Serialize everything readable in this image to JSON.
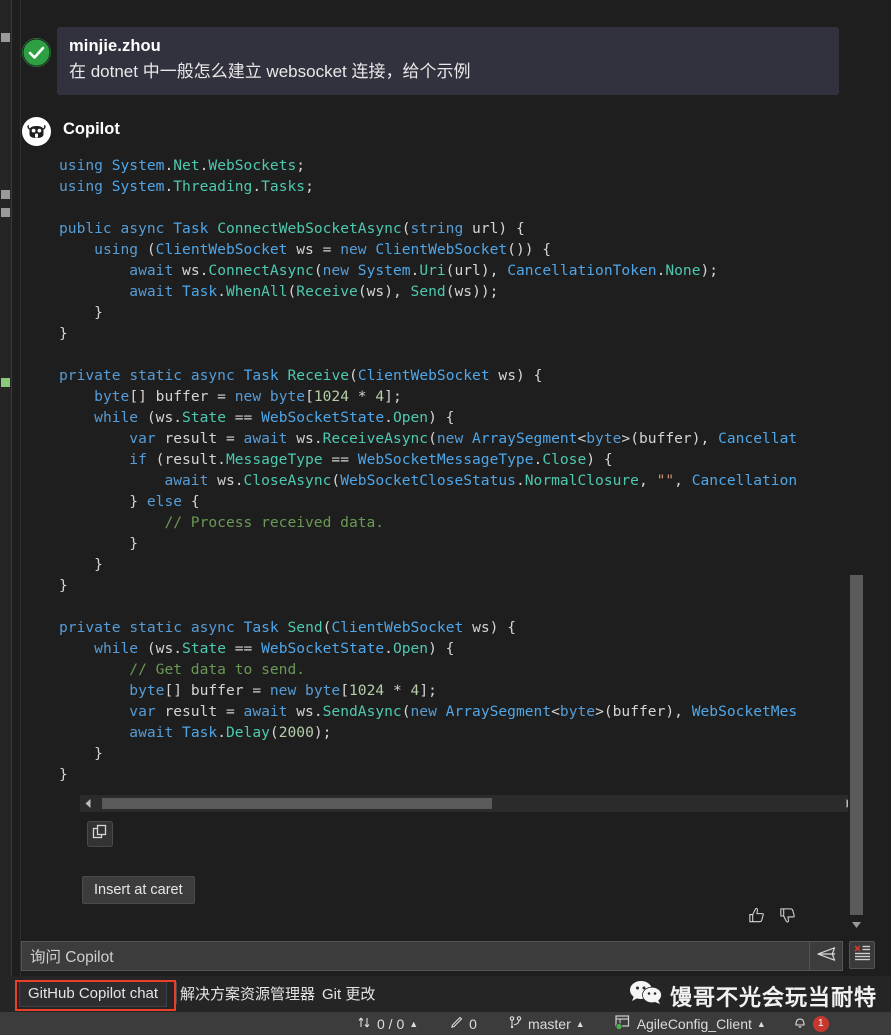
{
  "user_message": {
    "avatar_icon": "check-circle-icon",
    "name": "minjie.zhou",
    "text": "在 dotnet 中一般怎么建立 websocket 连接，给个示例"
  },
  "assistant": {
    "avatar_icon": "copilot-robot-icon",
    "name": "Copilot",
    "code": "using System.Net.WebSockets;\nusing System.Threading.Tasks;\n\npublic async Task ConnectWebSocketAsync(string url) {\n    using (ClientWebSocket ws = new ClientWebSocket()) {\n        await ws.ConnectAsync(new System.Uri(url), CancellationToken.None);\n        await Task.WhenAll(Receive(ws), Send(ws));\n    }\n}\n\nprivate static async Task Receive(ClientWebSocket ws) {\n    byte[] buffer = new byte[1024 * 4];\n    while (ws.State == WebSocketState.Open) {\n        var result = await ws.ReceiveAsync(new ArraySegment<byte>(buffer), Cancellat\n        if (result.MessageType == WebSocketMessageType.Close) {\n            await ws.CloseAsync(WebSocketCloseStatus.NormalClosure, \"\", Cancellation\n        } else {\n            // Process received data.\n        }\n    }\n}\n\nprivate static async Task Send(ClientWebSocket ws) {\n    while (ws.State == WebSocketState.Open) {\n        // Get data to send.\n        byte[] buffer = new byte[1024 * 4];\n        var result = await ws.SendAsync(new ArraySegment<byte>(buffer), WebSocketMes\n        await Task.Delay(2000);\n    }\n}"
  },
  "actions": {
    "copy_icon": "copy-icon",
    "insert_at_caret_label": "Insert at caret",
    "thumbs_up_icon": "thumbs-up-icon",
    "thumbs_down_icon": "thumbs-down-icon"
  },
  "input": {
    "placeholder": "询问 Copilot",
    "send_icon": "send-paper-plane-icon",
    "clear_icon": "clear-list-icon"
  },
  "tabs": [
    {
      "label": "GitHub Copilot chat",
      "active": true
    },
    {
      "label": "解决方案资源管理器",
      "active": false
    },
    {
      "label": "Git 更改",
      "active": false
    }
  ],
  "watermark": {
    "icon": "wechat-icon",
    "text": "馒哥不光会玩当耐特"
  },
  "statusbar": {
    "sync_icon": "sync-arrows-icon",
    "sync_count": "0 / 0",
    "edit_icon": "pencil-icon",
    "edit_count": "0",
    "branch_icon": "git-branch-icon",
    "branch_name": "master",
    "project_icon": "project-icon",
    "project_name": "AgileConfig_Client",
    "notification_icon": "bell-icon",
    "notification_count": "1"
  },
  "colors": {
    "background": "#1e1e1e",
    "user_bubble": "#32323e",
    "accent_green": "#2ea043",
    "highlight_red": "#e8402a",
    "statusbar": "#3c3c3c"
  }
}
